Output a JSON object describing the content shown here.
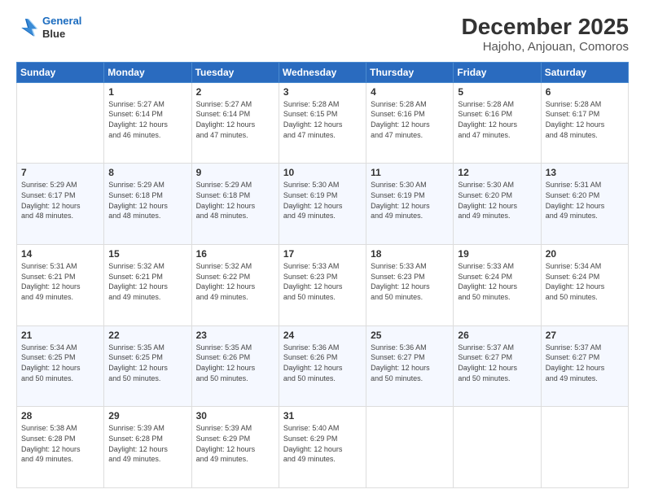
{
  "header": {
    "logo_line1": "General",
    "logo_line2": "Blue",
    "title": "December 2025",
    "subtitle": "Hajoho, Anjouan, Comoros"
  },
  "weekdays": [
    "Sunday",
    "Monday",
    "Tuesday",
    "Wednesday",
    "Thursday",
    "Friday",
    "Saturday"
  ],
  "weeks": [
    [
      {
        "num": "",
        "info": ""
      },
      {
        "num": "1",
        "info": "Sunrise: 5:27 AM\nSunset: 6:14 PM\nDaylight: 12 hours\nand 46 minutes."
      },
      {
        "num": "2",
        "info": "Sunrise: 5:27 AM\nSunset: 6:14 PM\nDaylight: 12 hours\nand 47 minutes."
      },
      {
        "num": "3",
        "info": "Sunrise: 5:28 AM\nSunset: 6:15 PM\nDaylight: 12 hours\nand 47 minutes."
      },
      {
        "num": "4",
        "info": "Sunrise: 5:28 AM\nSunset: 6:16 PM\nDaylight: 12 hours\nand 47 minutes."
      },
      {
        "num": "5",
        "info": "Sunrise: 5:28 AM\nSunset: 6:16 PM\nDaylight: 12 hours\nand 47 minutes."
      },
      {
        "num": "6",
        "info": "Sunrise: 5:28 AM\nSunset: 6:17 PM\nDaylight: 12 hours\nand 48 minutes."
      }
    ],
    [
      {
        "num": "7",
        "info": "Sunrise: 5:29 AM\nSunset: 6:17 PM\nDaylight: 12 hours\nand 48 minutes."
      },
      {
        "num": "8",
        "info": "Sunrise: 5:29 AM\nSunset: 6:18 PM\nDaylight: 12 hours\nand 48 minutes."
      },
      {
        "num": "9",
        "info": "Sunrise: 5:29 AM\nSunset: 6:18 PM\nDaylight: 12 hours\nand 48 minutes."
      },
      {
        "num": "10",
        "info": "Sunrise: 5:30 AM\nSunset: 6:19 PM\nDaylight: 12 hours\nand 49 minutes."
      },
      {
        "num": "11",
        "info": "Sunrise: 5:30 AM\nSunset: 6:19 PM\nDaylight: 12 hours\nand 49 minutes."
      },
      {
        "num": "12",
        "info": "Sunrise: 5:30 AM\nSunset: 6:20 PM\nDaylight: 12 hours\nand 49 minutes."
      },
      {
        "num": "13",
        "info": "Sunrise: 5:31 AM\nSunset: 6:20 PM\nDaylight: 12 hours\nand 49 minutes."
      }
    ],
    [
      {
        "num": "14",
        "info": "Sunrise: 5:31 AM\nSunset: 6:21 PM\nDaylight: 12 hours\nand 49 minutes."
      },
      {
        "num": "15",
        "info": "Sunrise: 5:32 AM\nSunset: 6:21 PM\nDaylight: 12 hours\nand 49 minutes."
      },
      {
        "num": "16",
        "info": "Sunrise: 5:32 AM\nSunset: 6:22 PM\nDaylight: 12 hours\nand 49 minutes."
      },
      {
        "num": "17",
        "info": "Sunrise: 5:33 AM\nSunset: 6:23 PM\nDaylight: 12 hours\nand 50 minutes."
      },
      {
        "num": "18",
        "info": "Sunrise: 5:33 AM\nSunset: 6:23 PM\nDaylight: 12 hours\nand 50 minutes."
      },
      {
        "num": "19",
        "info": "Sunrise: 5:33 AM\nSunset: 6:24 PM\nDaylight: 12 hours\nand 50 minutes."
      },
      {
        "num": "20",
        "info": "Sunrise: 5:34 AM\nSunset: 6:24 PM\nDaylight: 12 hours\nand 50 minutes."
      }
    ],
    [
      {
        "num": "21",
        "info": "Sunrise: 5:34 AM\nSunset: 6:25 PM\nDaylight: 12 hours\nand 50 minutes."
      },
      {
        "num": "22",
        "info": "Sunrise: 5:35 AM\nSunset: 6:25 PM\nDaylight: 12 hours\nand 50 minutes."
      },
      {
        "num": "23",
        "info": "Sunrise: 5:35 AM\nSunset: 6:26 PM\nDaylight: 12 hours\nand 50 minutes."
      },
      {
        "num": "24",
        "info": "Sunrise: 5:36 AM\nSunset: 6:26 PM\nDaylight: 12 hours\nand 50 minutes."
      },
      {
        "num": "25",
        "info": "Sunrise: 5:36 AM\nSunset: 6:27 PM\nDaylight: 12 hours\nand 50 minutes."
      },
      {
        "num": "26",
        "info": "Sunrise: 5:37 AM\nSunset: 6:27 PM\nDaylight: 12 hours\nand 50 minutes."
      },
      {
        "num": "27",
        "info": "Sunrise: 5:37 AM\nSunset: 6:27 PM\nDaylight: 12 hours\nand 49 minutes."
      }
    ],
    [
      {
        "num": "28",
        "info": "Sunrise: 5:38 AM\nSunset: 6:28 PM\nDaylight: 12 hours\nand 49 minutes."
      },
      {
        "num": "29",
        "info": "Sunrise: 5:39 AM\nSunset: 6:28 PM\nDaylight: 12 hours\nand 49 minutes."
      },
      {
        "num": "30",
        "info": "Sunrise: 5:39 AM\nSunset: 6:29 PM\nDaylight: 12 hours\nand 49 minutes."
      },
      {
        "num": "31",
        "info": "Sunrise: 5:40 AM\nSunset: 6:29 PM\nDaylight: 12 hours\nand 49 minutes."
      },
      {
        "num": "",
        "info": ""
      },
      {
        "num": "",
        "info": ""
      },
      {
        "num": "",
        "info": ""
      }
    ]
  ]
}
